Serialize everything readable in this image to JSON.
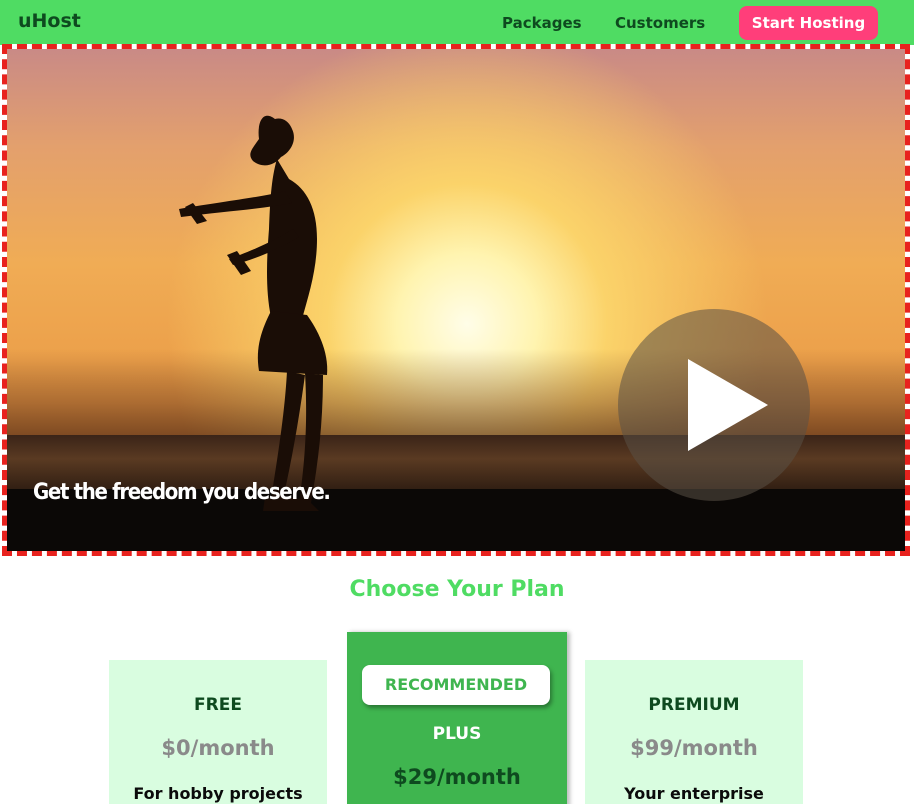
{
  "header": {
    "brand": "uHost",
    "nav": [
      "Packages",
      "Customers"
    ],
    "cta_label": "Start Hosting"
  },
  "hero": {
    "caption": "Get the freedom you deserve.",
    "play_icon": "play-icon"
  },
  "plans_section": {
    "title": "Choose Your Plan",
    "plans": [
      {
        "name": "FREE",
        "price": "$0/month",
        "desc": "For hobby projects"
      },
      {
        "badge": "RECOMMENDED",
        "name": "PLUS",
        "price": "$29/month"
      },
      {
        "name": "PREMIUM",
        "price": "$99/month",
        "desc": "Your enterprise"
      }
    ]
  },
  "colors": {
    "primary_green": "#4fdc63",
    "dark_green": "#0e4a1f",
    "cta_pink": "#ff3e7a",
    "plan_bg": "#d9fde0",
    "recommended_bg": "#3fb54f",
    "hero_border": "#e8221e"
  }
}
